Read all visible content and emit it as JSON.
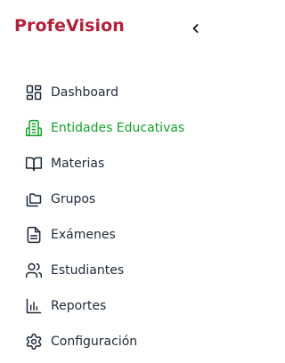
{
  "app": {
    "brand": "ProfeVision",
    "brand_color": "#b0213a"
  },
  "sidebar": {
    "collapse_icon": "chevron-left-icon",
    "active_color": "#15a02a",
    "items": [
      {
        "label": "Dashboard",
        "icon": "dashboard-grid-icon",
        "active": false
      },
      {
        "label": "Entidades Educativas",
        "icon": "building-icon",
        "active": true
      },
      {
        "label": "Materias",
        "icon": "book-open-icon",
        "active": false
      },
      {
        "label": "Grupos",
        "icon": "folders-icon",
        "active": false
      },
      {
        "label": "Exámenes",
        "icon": "file-text-icon",
        "active": false
      },
      {
        "label": "Estudiantes",
        "icon": "users-icon",
        "active": false
      },
      {
        "label": "Reportes",
        "icon": "bar-chart-icon",
        "active": false
      },
      {
        "label": "Configuración",
        "icon": "settings-gear-icon",
        "active": false
      }
    ]
  }
}
